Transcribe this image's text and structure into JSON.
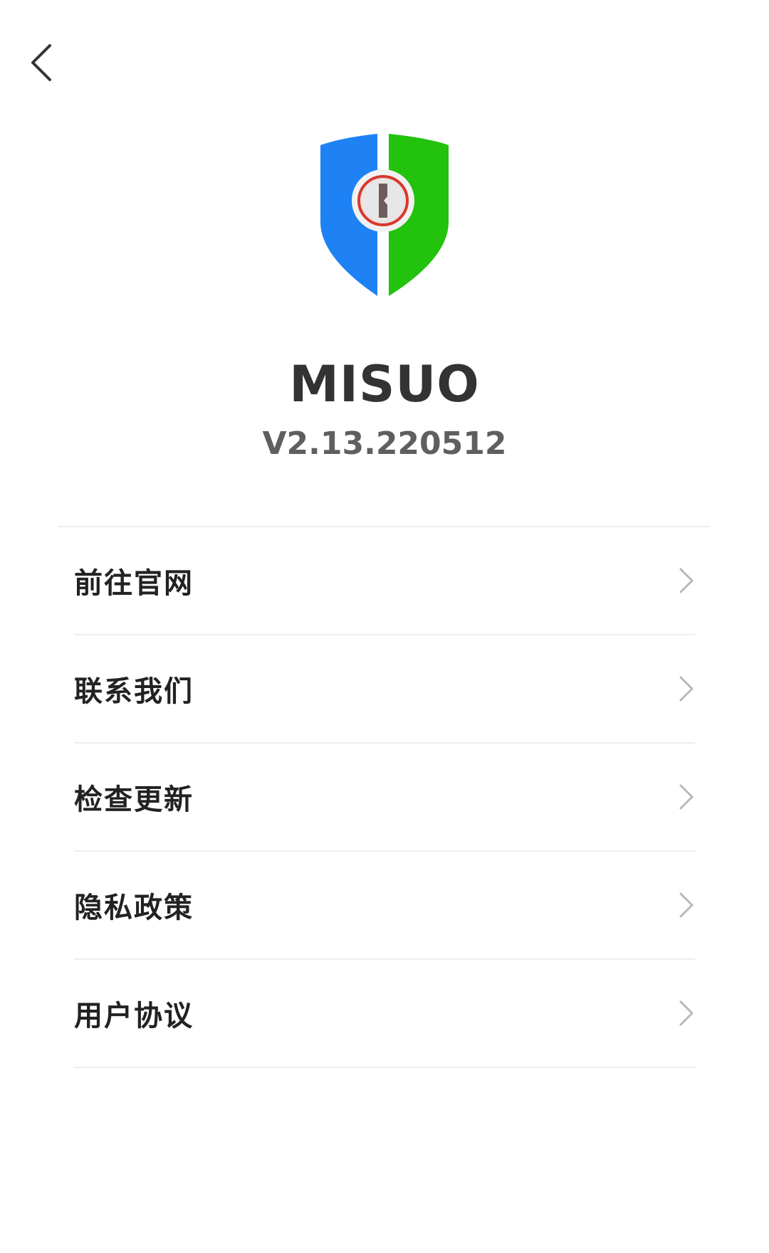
{
  "header": {
    "back_icon": "chevron-left-icon"
  },
  "app": {
    "logo_icon": "shield-keyhole-logo",
    "name": "MISUO",
    "version": "V2.13.220512",
    "colors": {
      "shield_blue": "#1e82f5",
      "shield_green": "#22c20d",
      "keyhole_red": "#d9382d"
    }
  },
  "menu": {
    "items": [
      {
        "label": "前往官网"
      },
      {
        "label": "联系我们"
      },
      {
        "label": "检查更新"
      },
      {
        "label": "隐私政策"
      },
      {
        "label": "用户协议"
      }
    ],
    "chevron_icon": "chevron-right-icon"
  }
}
